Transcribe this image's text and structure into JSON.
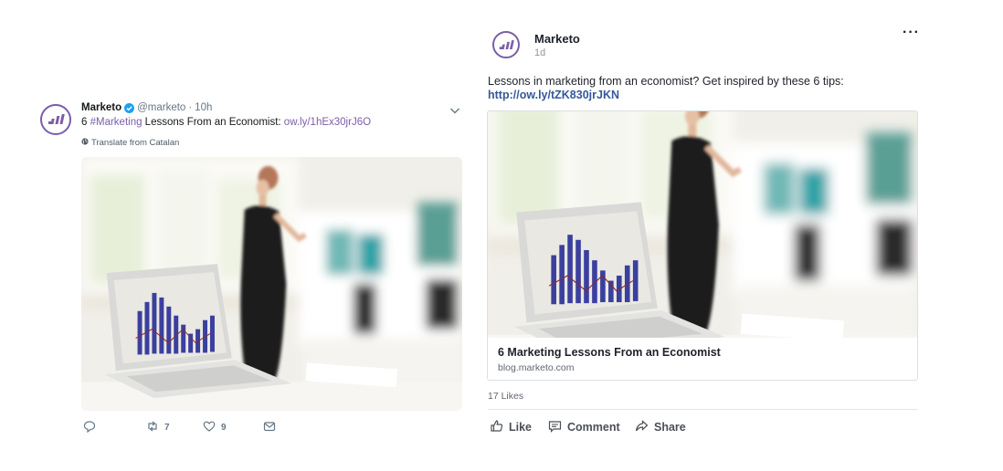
{
  "tweet": {
    "avatar_icon": "marketo-logo-icon",
    "name": "Marketo",
    "verified_icon": "verified-badge-icon",
    "handle": "@marketo",
    "separator": "·",
    "time": "10h",
    "text_prefix": "6 ",
    "hashtag": "#Marketing",
    "text_middle": " Lessons From an Economist: ",
    "link": "ow.ly/1hEx30jrJ6O",
    "translate_icon": "globe-icon",
    "translate_label": "Translate from Catalan",
    "actions": {
      "reply_icon": "reply-icon",
      "retweet_icon": "retweet-icon",
      "retweet_count": "7",
      "like_icon": "heart-icon",
      "like_count": "9",
      "dm_icon": "envelope-icon"
    }
  },
  "post": {
    "avatar_icon": "marketo-logo-icon",
    "name": "Marketo",
    "time": "1d",
    "more_label": "···",
    "text": "Lessons in marketing from an economist? Get inspired by these 6 tips:",
    "link": "http://ow.ly/tZK830jrJKN",
    "card": {
      "title": "6 Marketing Lessons From an Economist",
      "domain": "blog.marketo.com"
    },
    "likes": "17 Likes",
    "actions": {
      "like_label": "Like",
      "comment_label": "Comment",
      "share_label": "Share"
    }
  },
  "colors": {
    "marketo_purple": "#7b5ea7",
    "twitter_blue": "#1da1f2",
    "facebook_link": "#365899"
  }
}
